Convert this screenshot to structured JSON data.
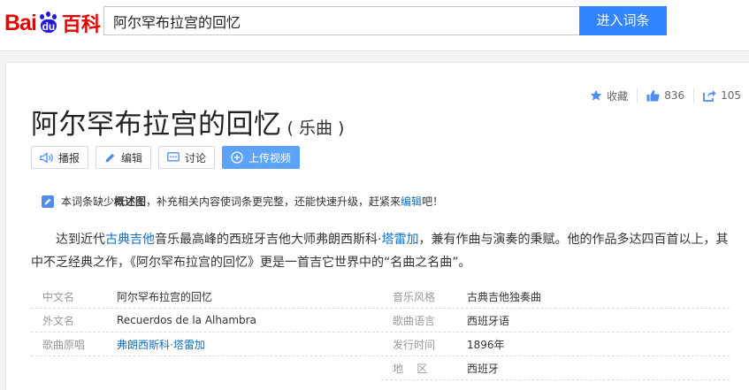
{
  "header": {
    "logo_bai": "Bai",
    "logo_du": "du",
    "logo_baike": "百科",
    "search_value": "阿尔罕布拉宫的回忆",
    "enter_button": "进入词条"
  },
  "actions": {
    "favorite": "收藏",
    "like_count": "836",
    "share_count": "105"
  },
  "title": {
    "main": "阿尔罕布拉宫的回忆",
    "sub": "( 乐曲 )"
  },
  "buttons": {
    "broadcast": "播报",
    "edit": "编辑",
    "discuss": "讨论",
    "upload_video": "上传视频"
  },
  "notice": {
    "p1": "本词条缺少",
    "p2": "概述图",
    "p3": "，补充相关内容使词条更完整，还能快速升级，赶紧来",
    "p4": "编辑",
    "p5": "吧！"
  },
  "summary": {
    "p1": "达到近代",
    "link1": "古典吉他",
    "p2": "音乐最高峰的西班牙吉他大师弗朗西斯科·",
    "link2": "塔雷加",
    "p3": "，兼有作曲与演奏的秉赋。他的作品多达四百首以上，其中不乏经典之作，《阿尔罕布拉宫的回忆》更是一首吉它世界中的“名曲之名曲”。"
  },
  "info": {
    "left": [
      {
        "label": "中文名",
        "value": "阿尔罕布拉宫的回忆"
      },
      {
        "label": "外文名",
        "value": "Recuerdos de la Alhambra"
      },
      {
        "label": "歌曲原唱",
        "value": "弗朗西斯科·塔雷加"
      }
    ],
    "right": [
      {
        "label": "音乐风格",
        "value": "古典吉他独奏曲"
      },
      {
        "label": "歌曲语言",
        "value": "西班牙语"
      },
      {
        "label": "发行时间",
        "value": "1896年"
      },
      {
        "label": "地    区",
        "value": "西班牙"
      }
    ]
  },
  "colors": {
    "brand_red": "#e10601",
    "brand_blue": "#2319dc",
    "search_button": "#3385ff",
    "link": "#136ec2",
    "upload_button": "#5ca3f9"
  }
}
